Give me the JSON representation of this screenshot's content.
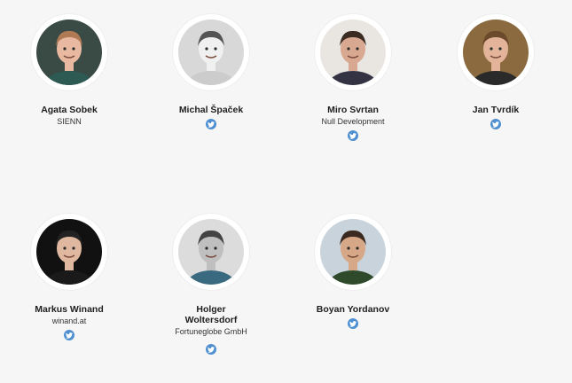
{
  "speakers": [
    {
      "name": "Agata Sobek",
      "company": "SIENN",
      "twitter": false,
      "avatar_icon": "person-photo-icon",
      "photo_bg": "#3a4a44",
      "skin": "#e8b8a0",
      "hair": "#b07a55",
      "shirt": "#2d5a52"
    },
    {
      "name": "Michal Špaček",
      "company": "",
      "twitter": true,
      "avatar_icon": "person-photo-icon",
      "photo_bg": "#d8d8d8",
      "skin": "#f0f0f0",
      "hair": "#555555",
      "shirt": "#cccccc"
    },
    {
      "name": "Miro Svrtan",
      "company": "Null Development",
      "twitter": true,
      "avatar_icon": "person-photo-icon",
      "photo_bg": "#e9e6e2",
      "skin": "#d9a890",
      "hair": "#3b2b22",
      "shirt": "#334"
    },
    {
      "name": "Jan Tvrdík",
      "company": "",
      "twitter": true,
      "avatar_icon": "person-photo-icon",
      "photo_bg": "#8a6a3e",
      "skin": "#e3b49a",
      "hair": "#6b4a2c",
      "shirt": "#2a2a2a"
    },
    {
      "name": "Markus Winand",
      "company": "winand.at",
      "twitter": true,
      "avatar_icon": "person-photo-icon",
      "photo_bg": "#111111",
      "skin": "#e0b8a0",
      "hair": "#222222",
      "shirt": "#1a1a1a"
    },
    {
      "name": "Holger Woltersdorf",
      "company": "Fortuneglobe GmbH",
      "twitter": true,
      "avatar_icon": "person-photo-icon",
      "photo_bg": "#dcdcdc",
      "skin": "#bfbfbf",
      "hair": "#444444",
      "shirt": "#3a6a80"
    },
    {
      "name": "Boyan Yordanov",
      "company": "",
      "twitter": true,
      "avatar_icon": "person-photo-icon",
      "photo_bg": "#c9d3dc",
      "skin": "#d6a888",
      "hair": "#3a2a20",
      "shirt": "#2f4a2a"
    }
  ],
  "colors": {
    "twitter": "#4d8fd0",
    "background": "#f6f6f6"
  }
}
